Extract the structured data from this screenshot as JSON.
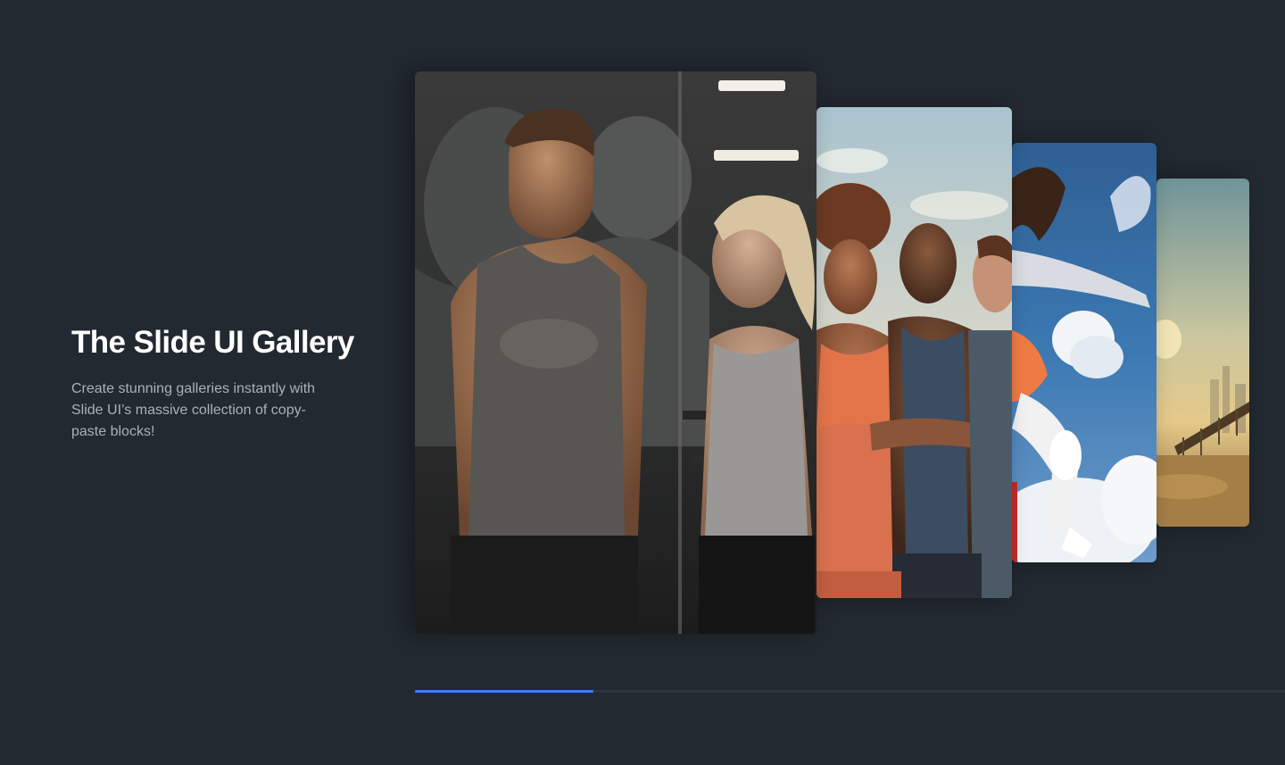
{
  "intro": {
    "title": "The Slide UI Gallery",
    "description": "Create stunning galleries instantly with Slide UI’s massive collection of copy-paste blocks!"
  },
  "gallery": {
    "slides": [
      {
        "subject": "gym couple facing each other"
      },
      {
        "subject": "three athletes with crossed arms"
      },
      {
        "subject": "jumping woman against blue sky"
      },
      {
        "subject": "city skyline with bridge at sunset"
      }
    ],
    "progress": 0.205
  },
  "colors": {
    "background": "#222930",
    "title": "#ffffff",
    "description": "#aab1ba",
    "progress_track": "#2d353d",
    "progress_fill": "#3b82f6"
  }
}
